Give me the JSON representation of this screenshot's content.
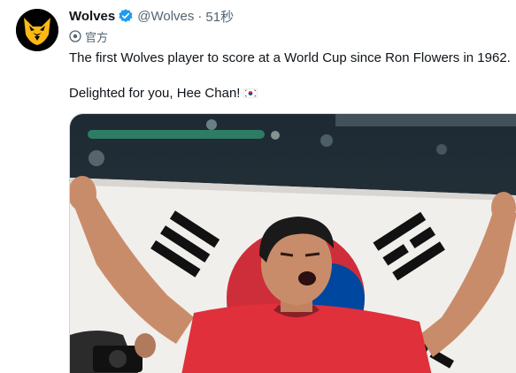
{
  "tweet": {
    "author": {
      "display_name": "Wolves",
      "handle": "@Wolves",
      "verified": true,
      "avatar_icon": "wolf-head-logo"
    },
    "separator": "·",
    "timestamp": "51秒",
    "official_label": "官方",
    "text_line1": "The first Wolves player to score at a World Cup since Ron Flowers in 1962.",
    "text_line2": "Delighted for you, Hee Chan!",
    "emoji": "south-korea-flag",
    "media": {
      "type": "photo",
      "subject": "player-holding-korean-flag"
    }
  },
  "colors": {
    "brand_gold": "#FDB913",
    "verified_blue": "#1D9BF0",
    "secondary_text": "#536471",
    "primary_text": "#0F1419",
    "jersey_red": "#E0303B"
  }
}
